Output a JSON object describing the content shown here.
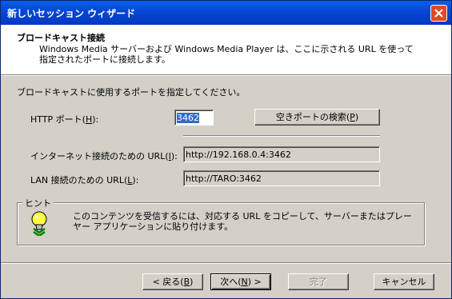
{
  "window": {
    "title": "新しいセッション ウィザード"
  },
  "header": {
    "title": "ブロードキャスト接続",
    "description": "Windows Media サーバーおよび Windows Media Player は、ここに示される URL を使って指定されたポートに接続します。"
  },
  "instruction": "ブロードキャストに使用するポートを指定してください。",
  "http_port": {
    "label_pre": "HTTP ポート(",
    "label_key": "H",
    "label_post": "):",
    "value": "3462"
  },
  "find_port_button": {
    "label_pre": "空きポートの検索(",
    "label_key": "P",
    "label_post": ")"
  },
  "internet_url": {
    "label_pre": "インターネット接続のための URL(",
    "label_key": "I",
    "label_post": "):",
    "value": "http://192.168.0.4:3462"
  },
  "lan_url": {
    "label_pre": "LAN 接続のための URL(",
    "label_key": "L",
    "label_post": "):",
    "value": "http://TARO:3462"
  },
  "hint": {
    "title": "ヒント",
    "text": "このコンテンツを受信するには、対応する URL をコピーして、サーバーまたはプレーヤー アプリケーションに貼り付けます。",
    "icon": "lightbulb-icon"
  },
  "buttons": {
    "back": {
      "label_pre": "< 戻る(",
      "label_key": "B",
      "label_post": ")"
    },
    "next": {
      "label_pre": "次へ(",
      "label_key": "N",
      "label_post": ") >"
    },
    "finish": "完了",
    "cancel": "キャンセル"
  },
  "colors": {
    "titlebar": "#0548d6",
    "close": "#e04a22",
    "face": "#d4d0c8",
    "selection": "#316ac5"
  }
}
